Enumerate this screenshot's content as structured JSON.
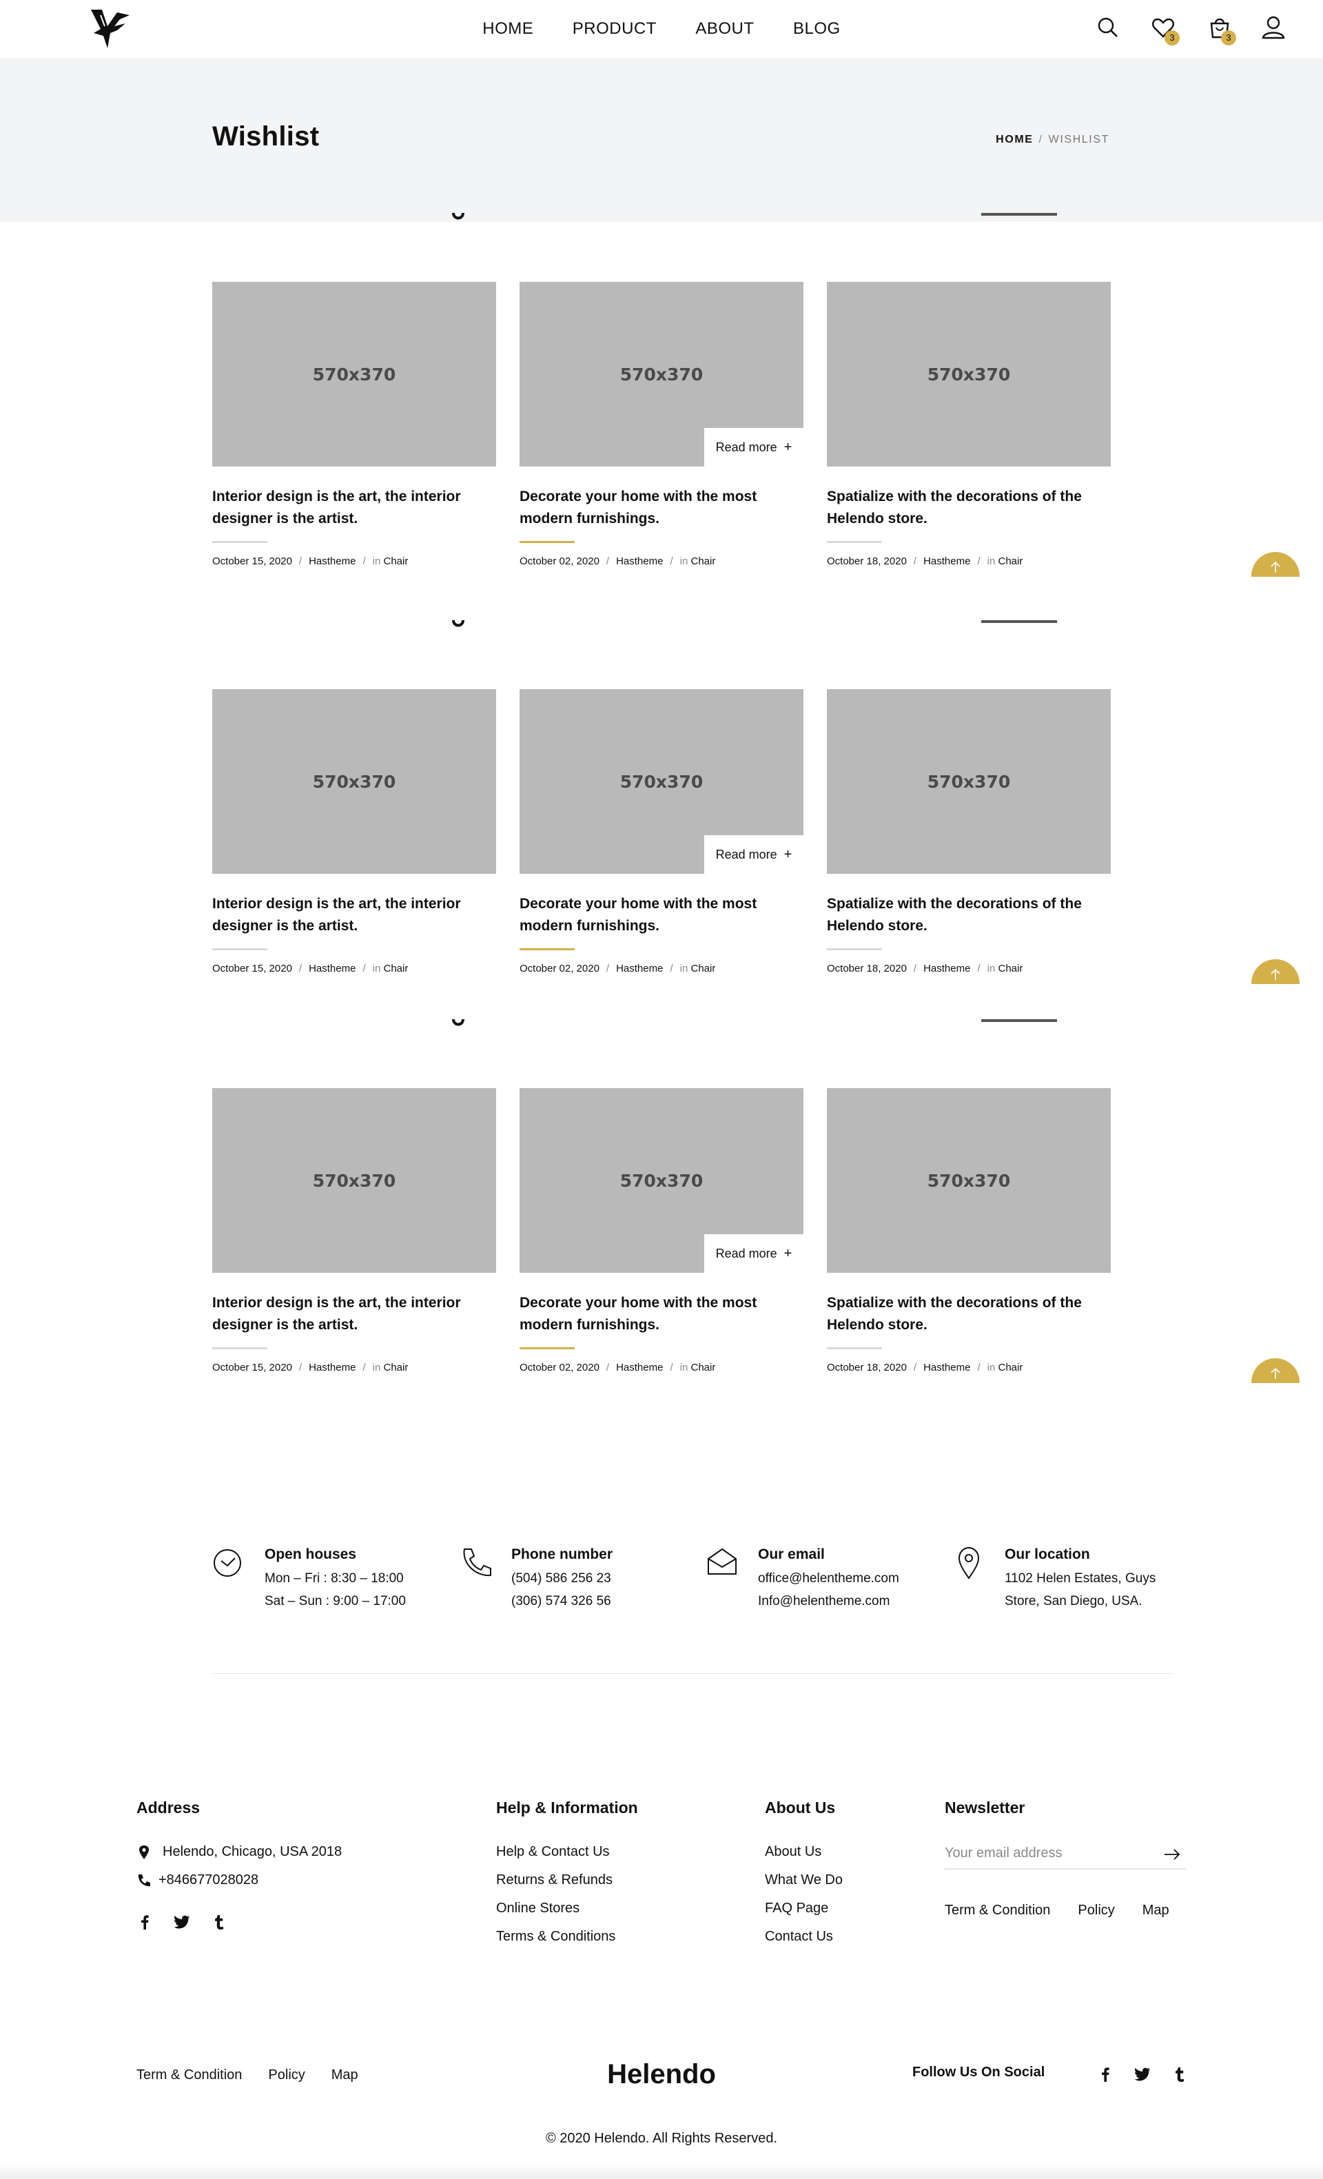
{
  "header": {
    "nav": [
      "HOME",
      "PRODUCT",
      "ABOUT",
      "BLOG"
    ],
    "wishlist_count": "3",
    "cart_count": "3"
  },
  "title_band": {
    "title": "Wishlist",
    "breadcrumb_home": "HOME",
    "breadcrumb_sep": "/",
    "breadcrumb_current": "WISHLIST"
  },
  "sections": [
    {
      "posts": [
        {
          "thumb": "570x370",
          "title": "Interior design is the art, the interior designer is the artist.",
          "date": "October 15, 2020",
          "author": "Hastheme",
          "in": "in",
          "category": "Chair"
        },
        {
          "thumb": "570x370",
          "title": "Decorate your home with the most modern furnishings.",
          "date": "October 02, 2020",
          "author": "Hastheme",
          "in": "in",
          "category": "Chair",
          "read_more": "Read more"
        },
        {
          "thumb": "570x370",
          "title": "Spatialize with the decorations of the Helendo store.",
          "date": "October 18, 2020",
          "author": "Hastheme",
          "in": "in",
          "category": "Chair"
        }
      ]
    },
    {
      "posts": [
        {
          "thumb": "570x370",
          "title": "Interior design is the art, the interior designer is the artist.",
          "date": "October 15, 2020",
          "author": "Hastheme",
          "in": "in",
          "category": "Chair"
        },
        {
          "thumb": "570x370",
          "title": "Decorate your home with the most modern furnishings.",
          "date": "October 02, 2020",
          "author": "Hastheme",
          "in": "in",
          "category": "Chair",
          "read_more": "Read more"
        },
        {
          "thumb": "570x370",
          "title": "Spatialize with the decorations of the Helendo store.",
          "date": "October 18, 2020",
          "author": "Hastheme",
          "in": "in",
          "category": "Chair"
        }
      ]
    },
    {
      "posts": [
        {
          "thumb": "570x370",
          "title": "Interior design is the art, the interior designer is the artist.",
          "date": "October 15, 2020",
          "author": "Hastheme",
          "in": "in",
          "category": "Chair"
        },
        {
          "thumb": "570x370",
          "title": "Decorate your home with the most modern furnishings.",
          "date": "October 02, 2020",
          "author": "Hastheme",
          "in": "in",
          "category": "Chair",
          "read_more": "Read more"
        },
        {
          "thumb": "570x370",
          "title": "Spatialize with the decorations of the Helendo store.",
          "date": "October 18, 2020",
          "author": "Hastheme",
          "in": "in",
          "category": "Chair"
        }
      ]
    }
  ],
  "contacts": [
    {
      "icon": "clock-icon",
      "title": "Open houses",
      "lines": [
        "Mon – Fri : 8:30 – 18:00",
        "Sat – Sun : 9:00 – 17:00"
      ]
    },
    {
      "icon": "phone-icon",
      "title": "Phone number",
      "lines": [
        "(504) 586 256 23",
        "(306) 574 326 56"
      ]
    },
    {
      "icon": "envelope-icon",
      "title": "Our email",
      "lines": [
        "office@helentheme.com",
        "Info@helentheme.com"
      ]
    },
    {
      "icon": "map-pin-icon",
      "title": "Our location",
      "lines": [
        "1102 Helen Estates, Guys",
        "Store, San Diego, USA."
      ]
    }
  ],
  "footer": {
    "address": {
      "heading": "Address",
      "location": "Helendo, Chicago, USA 2018",
      "phone": "+846677028028"
    },
    "help": {
      "heading": "Help & Information",
      "links": [
        "Help & Contact Us",
        "Returns & Refunds",
        "Online Stores",
        "Terms & Conditions"
      ]
    },
    "about": {
      "heading": "About Us",
      "links": [
        "About Us",
        "What We Do",
        "FAQ Page",
        "Contact Us"
      ]
    },
    "newsletter": {
      "heading": "Newsletter",
      "placeholder": "Your email address",
      "links": [
        "Term & Condition",
        "Policy",
        "Map"
      ]
    }
  },
  "bottom": {
    "links": [
      "Term & Condition",
      "Policy",
      "Map"
    ],
    "brand": "Helendo",
    "follow": "Follow Us On Social",
    "copyright": "© 2020 Helendo. All Rights Reserved."
  },
  "colors": {
    "accent": "#d4b04a",
    "band": "#f3f4f6",
    "placeholder": "#b9b9b9"
  }
}
